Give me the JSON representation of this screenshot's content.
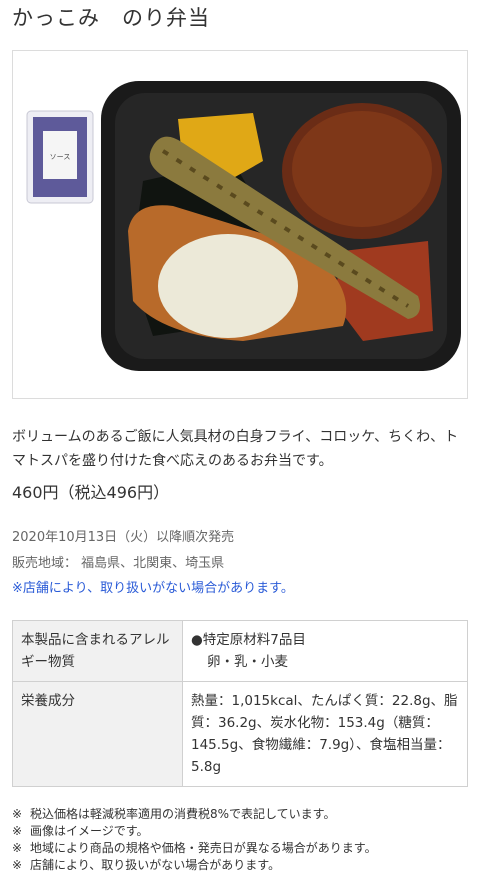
{
  "product": {
    "title": "かっこみ　のり弁当",
    "description": "ボリュームのあるご飯に人気具材の白身フライ、コロッケ、ちくわ、トマトスパを盛り付けた食べ応えのあるお弁当です。",
    "price": "460円（税込496円）",
    "release": "2020年10月13日（火）以降順次発売",
    "area": "販売地域：  福島県、北関東、埼玉県",
    "store_notice": "※店舗により、取り扱いがない場合があります。",
    "packet_text": "ソース"
  },
  "info_table": {
    "allergy_label": "本製品に含まれるアレルギー物質",
    "allergy_line1": "●特定原材料7品目",
    "allergy_line2": "卵・乳・小麦",
    "nutrition_label": "栄養成分",
    "nutrition_value": "熱量：1,015kcal、たんぱく質：22.8g、脂質：36.2g、炭水化物：153.4g（糖質：145.5g、食物繊維：7.9g）、食塩相当量：5.8g"
  },
  "notes": [
    {
      "mark": "※",
      "text": "税込価格は軽減税率適用の消費税8%で表記しています。"
    },
    {
      "mark": "※",
      "text": "画像はイメージです。"
    },
    {
      "mark": "※",
      "text": "地域により商品の規格や価格・発売日が異なる場合があります。"
    },
    {
      "mark": "※",
      "text": "店舗により、取り扱いがない場合があります。"
    }
  ]
}
